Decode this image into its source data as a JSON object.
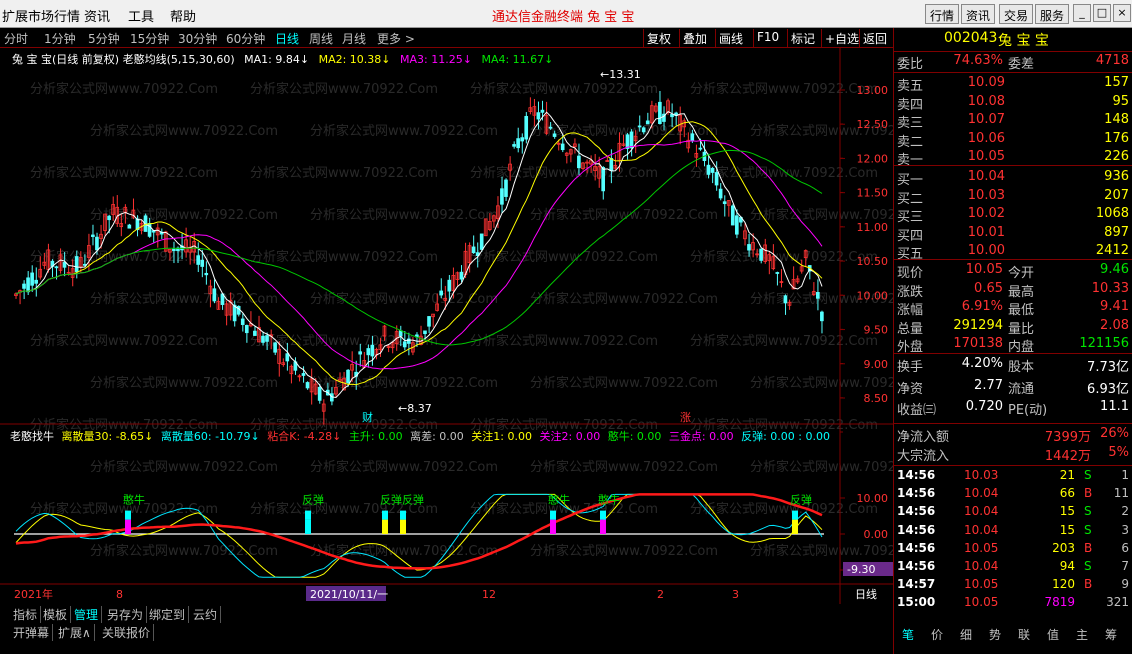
{
  "menu": {
    "items": [
      "扩展市场行情",
      "资讯",
      "工具",
      "帮助"
    ],
    "title": "通达信金融终端  兔 宝 宝",
    "right_buttons": [
      "行情",
      "资讯",
      "交易",
      "服务"
    ]
  },
  "periods": {
    "tabs": [
      "分时",
      "1分钟",
      "5分钟",
      "15分钟",
      "30分钟",
      "60分钟",
      "日线",
      "周线",
      "月线",
      "更多 >"
    ],
    "active": "日线",
    "tools": [
      "复权",
      "叠加",
      "画线",
      "F10",
      "标记",
      "+自选",
      "返回"
    ]
  },
  "main": {
    "title": "兔 宝 宝(日线 前复权) 老憨均线(5,15,30,60)",
    "ma1": "MA1: 9.84↓",
    "ma2": "MA2: 10.38↓",
    "ma3": "MA3: 11.25↓",
    "ma4": "MA4: 11.67↓",
    "high_label": "13.31",
    "low_label": "8.37",
    "marker_cai": "财",
    "marker_zhang": "涨",
    "y_ticks": [
      "13.00",
      "12.50",
      "12.00",
      "11.50",
      "11.00",
      "10.50",
      "10.00",
      "9.50",
      "9.00",
      "8.50"
    ]
  },
  "sub": {
    "name": "老憨找牛",
    "f1": "离散量30: -8.65↓",
    "f2": "离散量60: -10.79↓",
    "f3": "粘合K: -4.28↓",
    "f4": "主升: 0.00",
    "f5": "离差: 0.00",
    "f6": "关注1: 0.00",
    "f7": "关注2: 0.00",
    "f8": "憨牛: 0.00",
    "f9": "三金点: 0.00",
    "f10": "反弹: 0.00 : 0.00",
    "y_ticks": [
      "10.00",
      "0.00",
      "-10.00"
    ],
    "cur_value": "-9.30",
    "signal_labels": [
      "憨牛",
      "反弹",
      "反弹反弹",
      "憨牛",
      "憨牛",
      "反弹"
    ],
    "date_label": "2021/10/11/一",
    "year_label": "2021年",
    "month_labels": [
      "8",
      "12",
      "2",
      "3"
    ],
    "period_label": "日线"
  },
  "bottom_tabs": [
    "指标",
    "模板",
    "管理",
    "另存为",
    "绑定到",
    "云约"
  ],
  "bottom_tabs_active": "管理",
  "bottom_tabs2": [
    "开弹幕",
    "扩展∧",
    "关联报价"
  ],
  "stock": {
    "code": "002043",
    "name": "兔 宝 宝",
    "weibi_label": "委比",
    "weibi": "74.63%",
    "weicha_label": "委差",
    "weicha": "4718",
    "asks": [
      {
        "label": "卖五",
        "price": "10.09",
        "vol": "157"
      },
      {
        "label": "卖四",
        "price": "10.08",
        "vol": "95"
      },
      {
        "label": "卖三",
        "price": "10.07",
        "vol": "148"
      },
      {
        "label": "卖二",
        "price": "10.06",
        "vol": "176"
      },
      {
        "label": "卖一",
        "price": "10.05",
        "vol": "226"
      }
    ],
    "bids": [
      {
        "label": "买一",
        "price": "10.04",
        "vol": "936"
      },
      {
        "label": "买二",
        "price": "10.03",
        "vol": "207"
      },
      {
        "label": "买三",
        "price": "10.02",
        "vol": "1068"
      },
      {
        "label": "买四",
        "price": "10.01",
        "vol": "897"
      },
      {
        "label": "买五",
        "price": "10.00",
        "vol": "2412"
      }
    ],
    "quote": [
      {
        "l1": "现价",
        "v1": "10.05",
        "c1": "red",
        "l2": "今开",
        "v2": "9.46",
        "c2": "grn"
      },
      {
        "l1": "涨跌",
        "v1": "0.65",
        "c1": "red",
        "l2": "最高",
        "v2": "10.33",
        "c2": "red"
      },
      {
        "l1": "涨幅",
        "v1": "6.91%",
        "c1": "red",
        "l2": "最低",
        "v2": "9.41",
        "c2": "red"
      },
      {
        "l1": "总量",
        "v1": "291294",
        "c1": "yel",
        "l2": "量比",
        "v2": "2.08",
        "c2": "red"
      },
      {
        "l1": "外盘",
        "v1": "170138",
        "c1": "red",
        "l2": "内盘",
        "v2": "121156",
        "c2": "grn"
      }
    ],
    "quote2": [
      {
        "l1": "换手",
        "v1": "4.20%",
        "l2": "股本",
        "v2": "7.73亿"
      },
      {
        "l1": "净资",
        "v1": "2.77",
        "l2": "流通",
        "v2": "6.93亿"
      },
      {
        "l1": "收益㈢",
        "v1": "0.720",
        "l2": "PE(动)",
        "v2": "11.1"
      }
    ],
    "flow": [
      {
        "label": "净流入额",
        "value": "7399万",
        "pct": "26%"
      },
      {
        "label": "大宗流入",
        "value": "1442万",
        "pct": "5%"
      }
    ],
    "ticks": [
      {
        "t": "14:56",
        "p": "10.03",
        "v": "21",
        "bs": "S",
        "n": "1"
      },
      {
        "t": "14:56",
        "p": "10.04",
        "v": "66",
        "bs": "B",
        "n": "11"
      },
      {
        "t": "14:56",
        "p": "10.04",
        "v": "15",
        "bs": "S",
        "n": "2"
      },
      {
        "t": "14:56",
        "p": "10.04",
        "v": "15",
        "bs": "S",
        "n": "3"
      },
      {
        "t": "14:56",
        "p": "10.05",
        "v": "203",
        "bs": "B",
        "n": "6"
      },
      {
        "t": "14:56",
        "p": "10.04",
        "v": "94",
        "bs": "S",
        "n": "7"
      },
      {
        "t": "14:57",
        "p": "10.05",
        "v": "120",
        "bs": "B",
        "n": "9"
      },
      {
        "t": "15:00",
        "p": "10.05",
        "v": "7819",
        "bs": "",
        "n": "321"
      }
    ],
    "tabs": [
      "笔",
      "价",
      "细",
      "势",
      "联",
      "值",
      "主",
      "筹"
    ]
  },
  "watermark": "分析家公式网www.70922.Com"
}
